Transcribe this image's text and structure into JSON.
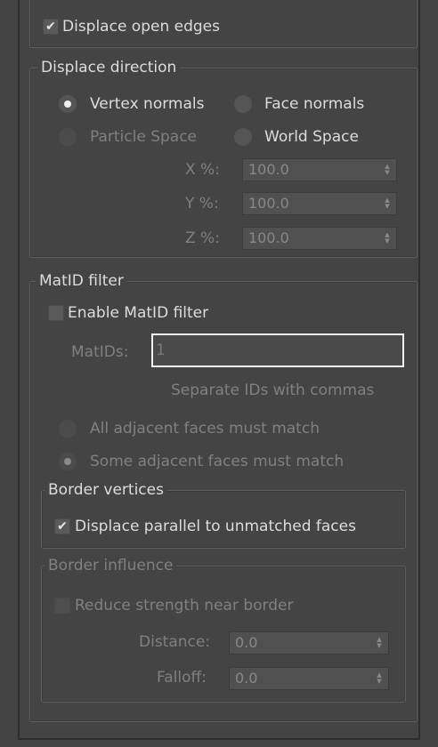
{
  "displace_open_edges": {
    "label": "Displace open edges",
    "checked": true
  },
  "displace_direction": {
    "title": "Displace direction",
    "vertex_normals": "Vertex normals",
    "face_normals": "Face normals",
    "particle_space": "Particle Space",
    "world_space": "World Space",
    "selected": "Vertex normals",
    "x_label": "X %:",
    "x_value": "100.0",
    "y_label": "Y %:",
    "y_value": "100.0",
    "z_label": "Z %:",
    "z_value": "100.0"
  },
  "matid_filter": {
    "title": "MatID filter",
    "enable_label": "Enable MatID filter",
    "enable_checked": false,
    "matids_label": "MatIDs:",
    "matids_value": "1",
    "hint": "Separate IDs with commas",
    "all_adjacent": "All adjacent faces must match",
    "some_adjacent": "Some adjacent faces must match",
    "selected": "Some adjacent faces must match"
  },
  "border_vertices": {
    "title": "Border vertices",
    "parallel_label": "Displace parallel to unmatched faces",
    "parallel_checked": true
  },
  "border_influence": {
    "title": "Border influence",
    "reduce_label": "Reduce strength near border",
    "reduce_checked": false,
    "distance_label": "Distance:",
    "distance_value": "0.0",
    "falloff_label": "Falloff:",
    "falloff_value": "0.0"
  },
  "icons": {
    "check": "✔",
    "spin_up": "▲",
    "spin_down": "▼"
  }
}
